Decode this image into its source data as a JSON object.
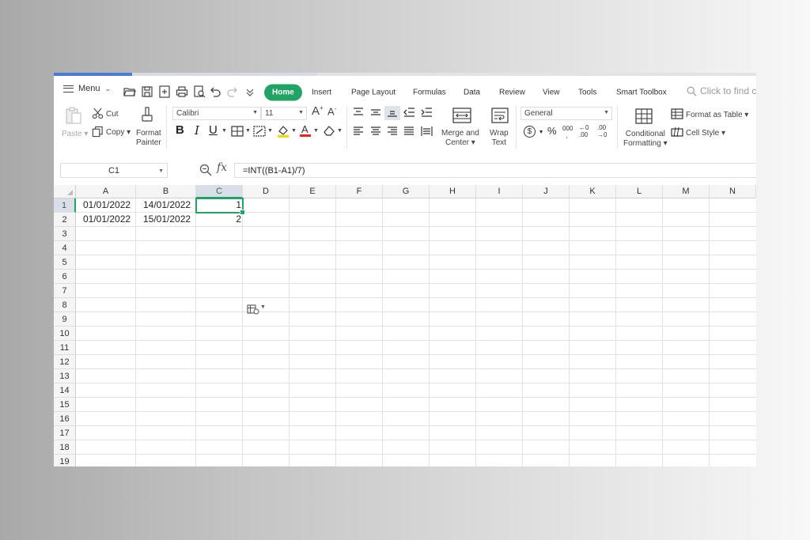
{
  "menu": {
    "label": "Menu"
  },
  "tabs": [
    "Home",
    "Insert",
    "Page Layout",
    "Formulas",
    "Data",
    "Review",
    "View",
    "Tools",
    "Smart Toolbox"
  ],
  "search": {
    "placeholder": "Click to find c"
  },
  "ribbon": {
    "paste": "Paste",
    "cut": "Cut",
    "copy": "Copy",
    "format_painter_1": "Format",
    "format_painter_2": "Painter",
    "font_name": "Calibri",
    "font_size": "11",
    "bold": "B",
    "italic": "I",
    "underline": "U",
    "merge_1": "Merge and",
    "merge_2": "Center",
    "wrap_1": "Wrap",
    "wrap_2": "Text",
    "number_format": "General",
    "currency": "$",
    "percent": "%",
    "thousands": "000",
    "inc_decimal": "←0 .00",
    "dec_decimal": ".00 →0",
    "cond_1": "Conditional",
    "cond_2": "Formatting",
    "format_table": "Format as Table",
    "cell_style": "Cell Style"
  },
  "formula_bar": {
    "name_box": "C1",
    "fx": "fx",
    "formula": "=INT((B1-A1)/7)"
  },
  "sheet": {
    "columns": [
      "A",
      "B",
      "C",
      "D",
      "E",
      "F",
      "G",
      "H",
      "I",
      "J",
      "K",
      "L",
      "M",
      "N"
    ],
    "rows": [
      "1",
      "2",
      "3",
      "4",
      "5",
      "6",
      "7",
      "8",
      "9",
      "10",
      "11",
      "12",
      "13",
      "14",
      "15",
      "16",
      "17",
      "18",
      "19"
    ],
    "active_cell": "C1",
    "cells": {
      "A1": "01/01/2022",
      "B1": "14/01/2022",
      "C1": "1",
      "A2": "01/01/2022",
      "B2": "15/01/2022",
      "C2": "2"
    }
  },
  "colors": {
    "accent": "#21a366",
    "selection_header": "#d9dee8"
  }
}
